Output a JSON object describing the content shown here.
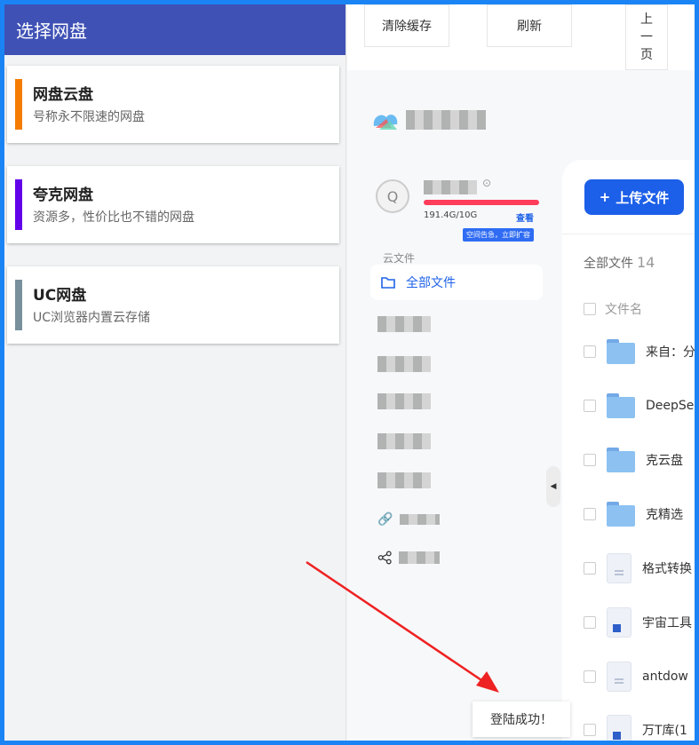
{
  "drawer": {
    "title": "选择网盘",
    "items": [
      {
        "name": "网盘云盘",
        "desc": "号称永不限速的网盘",
        "color": "#f57c00"
      },
      {
        "name": "夸克网盘",
        "desc": "资源多，性价比也不错的网盘",
        "color": "#6200ea"
      },
      {
        "name": "UC网盘",
        "desc": "UC浏览器内置云存储",
        "color": "#78909c"
      }
    ]
  },
  "toolbar": {
    "clear_cache": "清除缓存",
    "refresh": "刷新",
    "prev_page": [
      "上",
      "一",
      "页"
    ]
  },
  "account": {
    "avatar_letter": "Q",
    "quota": "191.4G/10G",
    "view": "查看",
    "expand_tag": "空间告急，立即扩容"
  },
  "sidebar": {
    "section": "云文件",
    "active": "全部文件"
  },
  "main": {
    "upload": "上传文件",
    "all_files": "全部文件",
    "count": "14",
    "col_name": "文件名",
    "files": [
      {
        "name": "来自：分",
        "type": "folder"
      },
      {
        "name": "DeepSe",
        "type": "folder"
      },
      {
        "name": "克云盘",
        "type": "folder"
      },
      {
        "name": "克精选",
        "type": "folder"
      },
      {
        "name": "格式转换",
        "type": "doc"
      },
      {
        "name": "宇宙工具",
        "type": "exe"
      },
      {
        "name": "antdow",
        "type": "doc"
      },
      {
        "name": "万T库(1",
        "type": "exe"
      }
    ]
  },
  "toast": "登陆成功！",
  "colors": {
    "accent": "#1c5fe8",
    "header": "#3f51b5",
    "annotation": "#ee2222"
  }
}
